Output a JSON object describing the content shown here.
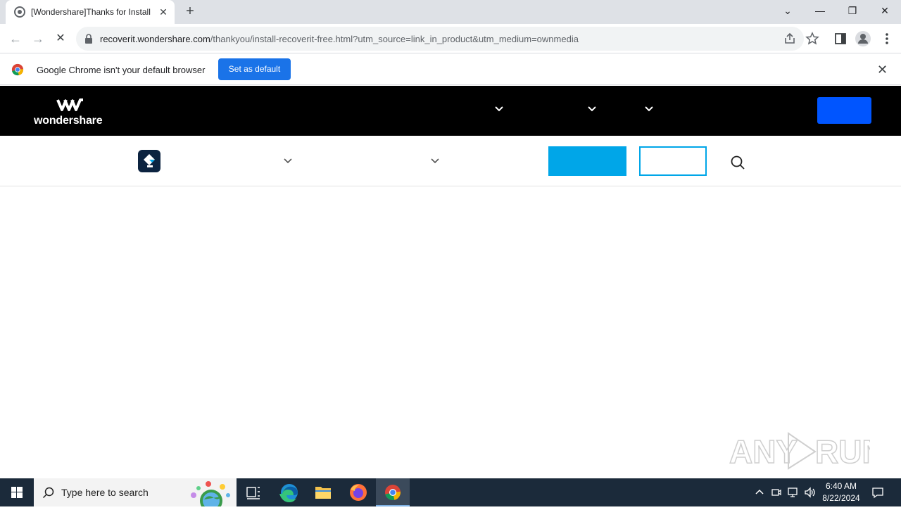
{
  "browser": {
    "tab_title": "[Wondershare]Thanks for Installing",
    "tab_close": "✕",
    "new_tab": "+",
    "url_domain": "recoverit.wondershare.com",
    "url_path": "/thankyou/install-recoverit-free.html?utm_source=link_in_product&utm_medium=ownmedia",
    "window_controls": {
      "tab_search": "⌄",
      "minimize": "—",
      "restore": "❐",
      "close": "✕"
    },
    "nav": {
      "back": "←",
      "forward": "→",
      "reload": "✕"
    }
  },
  "infobar": {
    "message": "Google Chrome isn't your default browser",
    "button_label": "Set as default",
    "close": "✕"
  },
  "site": {
    "brand_name": "wondershare",
    "brand_color": "#000000",
    "cta_color": "#0055ff",
    "accent_color": "#00a6e8"
  },
  "taskbar": {
    "search_placeholder": "Type here to search",
    "time": "6:40 AM",
    "date": "8/22/2024",
    "apps": [
      "task-view-icon",
      "edge-icon",
      "file-explorer-icon",
      "firefox-icon",
      "chrome-icon"
    ]
  },
  "watermark": {
    "text": "ANY RUN"
  }
}
